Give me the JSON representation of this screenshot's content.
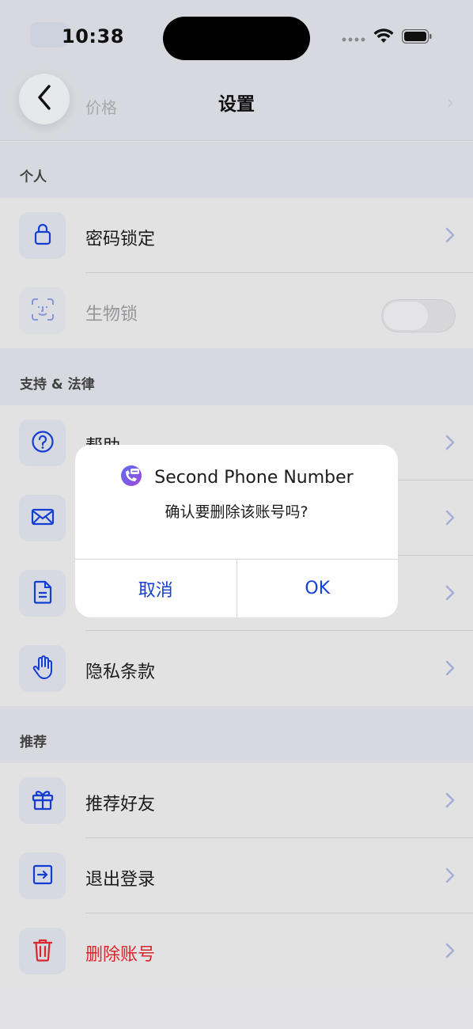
{
  "status_bar": {
    "time": "10:38"
  },
  "header": {
    "title": "设置",
    "ghost_price_label": "价格"
  },
  "sections": {
    "personal": {
      "title": "个人",
      "items": [
        {
          "label": "密码锁定",
          "icon": "lock-icon"
        },
        {
          "label": "生物锁",
          "icon": "face-id-icon",
          "toggle_on": false
        }
      ]
    },
    "support": {
      "title": "支持 & 法律",
      "items": [
        {
          "label": "帮助",
          "icon": "help-icon"
        },
        {
          "label": "",
          "icon": "mail-icon"
        },
        {
          "label": "",
          "icon": "document-icon"
        },
        {
          "label": "隐私条款",
          "icon": "hand-icon"
        }
      ]
    },
    "recommend": {
      "title": "推荐",
      "items": [
        {
          "label": "推荐好友",
          "icon": "gift-icon"
        },
        {
          "label": "退出登录",
          "icon": "logout-icon"
        },
        {
          "label": "删除账号",
          "icon": "trash-icon"
        }
      ]
    }
  },
  "dialog": {
    "app_name": "Second Phone Number",
    "message": "确认要删除该账号吗?",
    "cancel_label": "取消",
    "ok_label": "OK"
  },
  "colors": {
    "accent": "#1540d8",
    "danger": "#e0282e",
    "section_bg": "#dfe1e8",
    "row_bg": "#eaeaea"
  }
}
